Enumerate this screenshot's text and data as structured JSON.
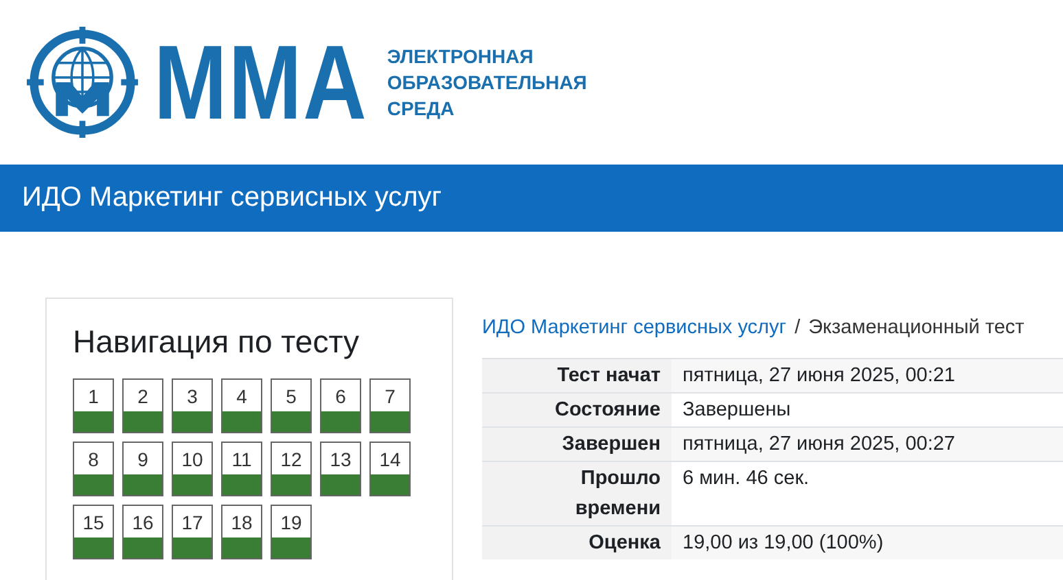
{
  "logo": {
    "name": "ММА",
    "subtitle": [
      "ЭЛЕКТРОННАЯ",
      "ОБРАЗОВАТЕЛЬНАЯ",
      "СРЕДА"
    ]
  },
  "course_bar": {
    "title": "ИДО Маркетинг сервисных услуг"
  },
  "quiz_nav": {
    "title": "Навигация по тесту",
    "questions": [
      {
        "label": "1",
        "correct": true
      },
      {
        "label": "2",
        "correct": true
      },
      {
        "label": "3",
        "correct": true
      },
      {
        "label": "4",
        "correct": true
      },
      {
        "label": "5",
        "correct": true
      },
      {
        "label": "6",
        "correct": true
      },
      {
        "label": "7",
        "correct": true
      },
      {
        "label": "8",
        "correct": true
      },
      {
        "label": "9",
        "correct": true
      },
      {
        "label": "10",
        "correct": true
      },
      {
        "label": "11",
        "correct": true
      },
      {
        "label": "12",
        "correct": true
      },
      {
        "label": "13",
        "correct": true
      },
      {
        "label": "14",
        "correct": true
      },
      {
        "label": "15",
        "correct": true
      },
      {
        "label": "16",
        "correct": true
      },
      {
        "label": "17",
        "correct": true
      },
      {
        "label": "18",
        "correct": true
      },
      {
        "label": "19",
        "correct": true
      }
    ]
  },
  "breadcrumb": {
    "items": [
      "ИДО Маркетинг сервисных услуг",
      "Экзаменационный тест"
    ],
    "separator": "/"
  },
  "summary": [
    {
      "label": "Тест начат",
      "value": "пятница, 27 июня 2025, 00:21"
    },
    {
      "label": "Состояние",
      "value": "Завершены"
    },
    {
      "label": "Завершен",
      "value": "пятница, 27 июня 2025, 00:27"
    },
    {
      "label": "Прошло времени",
      "value": "6 мин. 46 сек."
    },
    {
      "label": "Оценка",
      "value": "19,00 из 19,00 (100%)"
    }
  ]
}
